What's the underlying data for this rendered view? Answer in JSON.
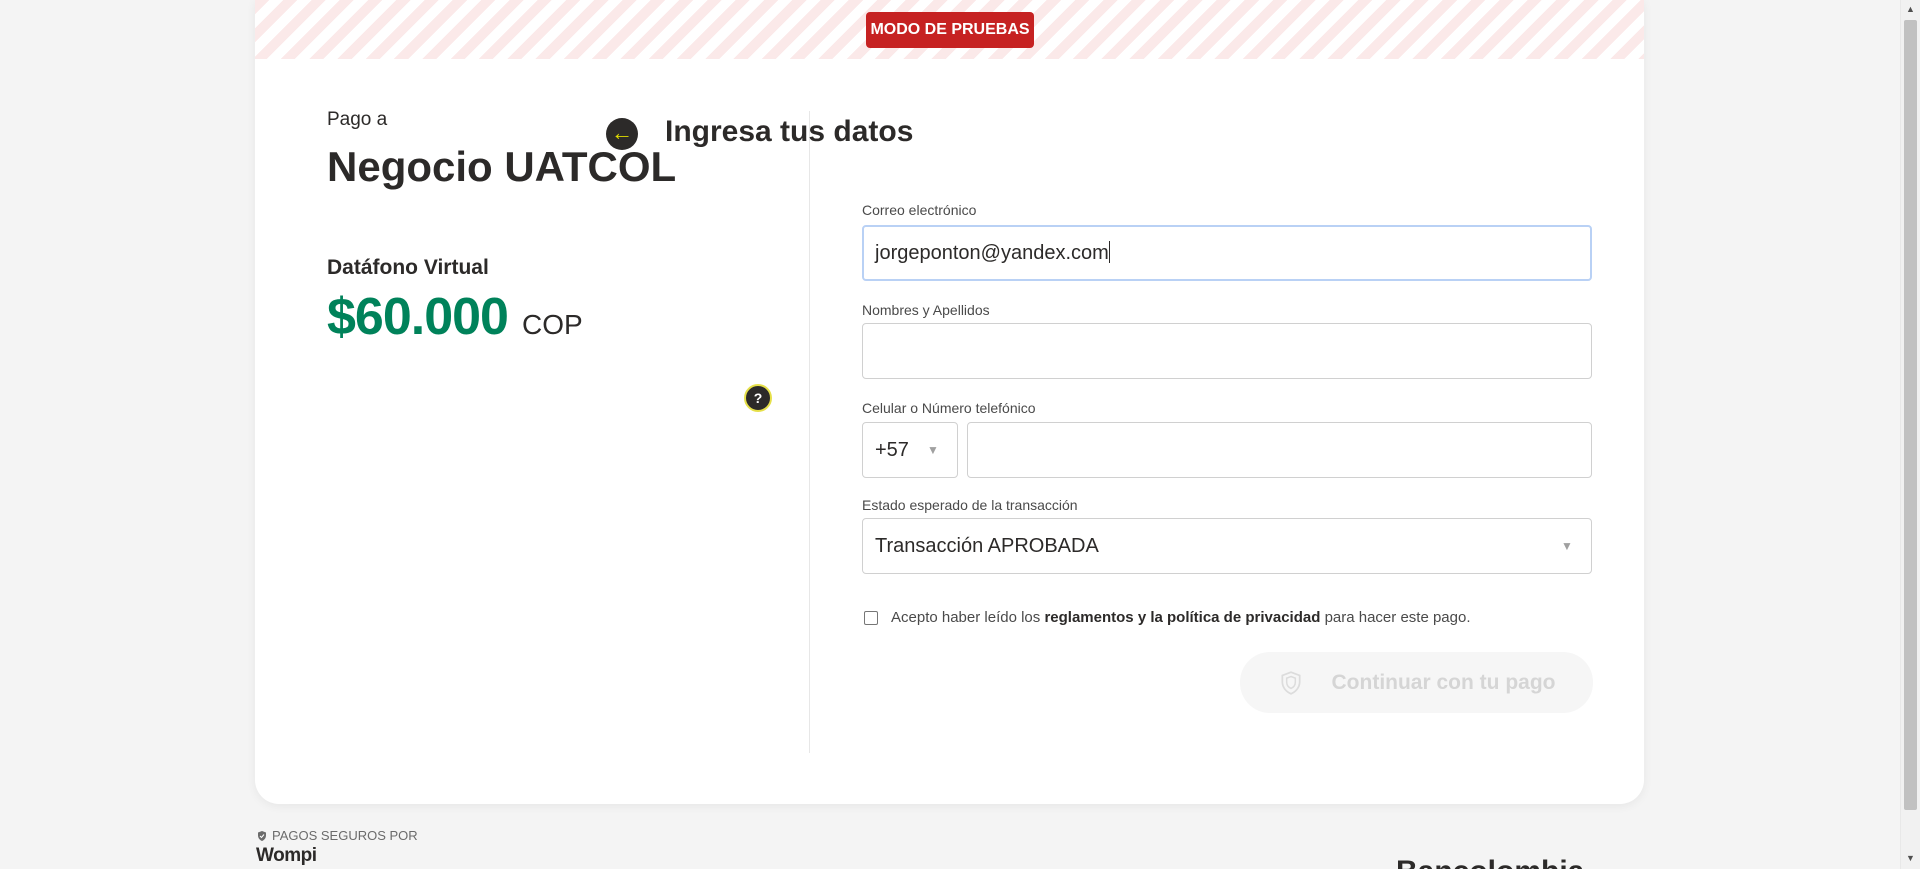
{
  "banner": {
    "test_mode": "MODO DE PRUEBAS"
  },
  "merchant": {
    "pay_to_label": "Pago a",
    "name": "Negocio UATCOL",
    "product": "Datáfono Virtual",
    "amount": "$60.000",
    "currency": "COP",
    "help_icon_glyph": "?"
  },
  "form": {
    "title": "Ingresa tus datos",
    "back_icon_glyph": "←",
    "email": {
      "label": "Correo electrónico",
      "value": "jorgeponton@yandex.com"
    },
    "name": {
      "label": "Nombres y Apellidos",
      "value": ""
    },
    "phone": {
      "label": "Celular o Número telefónico",
      "prefix": "+57",
      "value": ""
    },
    "status": {
      "label": "Estado esperado de la transacción",
      "selected": "Transacción APROBADA"
    },
    "terms": {
      "prefix": "Acepto haber leído los",
      "link": "reglamentos y la política de privacidad",
      "suffix": "para hacer este pago.",
      "checked": false
    },
    "continue_label": "Continuar con tu pago"
  },
  "footer": {
    "secure_label": "PAGOS SEGUROS POR",
    "brand": "Wompi",
    "partner": "Bancolombia"
  },
  "colors": {
    "amount": "#00825a",
    "test_badge": "#c62222",
    "back_icon_accent": "#dfdb00"
  }
}
